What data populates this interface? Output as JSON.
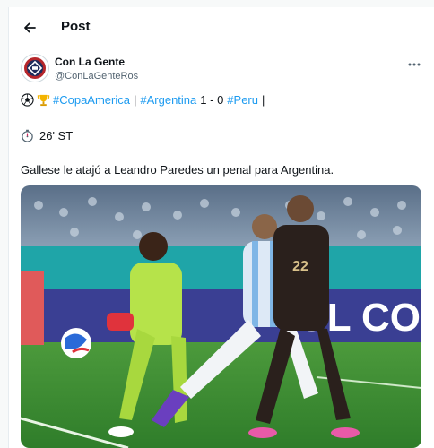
{
  "header": {
    "title": "Post"
  },
  "author": {
    "name": "Con La Gente",
    "handle": "@ConLaGenteRos"
  },
  "tweet": {
    "hashtag_1": "#CopaAmerica",
    "separator_1": "|",
    "hashtag_2": "#Argentina",
    "score": "1 - 0",
    "hashtag_3": "#Peru",
    "separator_2": "|",
    "minute": "26' ST",
    "body": "Gallese le atajó a Leandro Paredes un penal para Argentina."
  },
  "media": {
    "banner_text": "OL CO",
    "jersey_number": "22"
  },
  "colors": {
    "link": "#1d9bf0",
    "text": "#0f1419",
    "secondary_text": "#536471",
    "pitch": "#3b8a33",
    "goalkeeper_kit": "#b6e34a",
    "peru_kit": "#2a201c"
  },
  "icons": [
    "back-arrow-icon",
    "avatar-logo-icon",
    "more-options-icon",
    "soccer-ball-icon",
    "trophy-icon",
    "stopwatch-icon"
  ]
}
